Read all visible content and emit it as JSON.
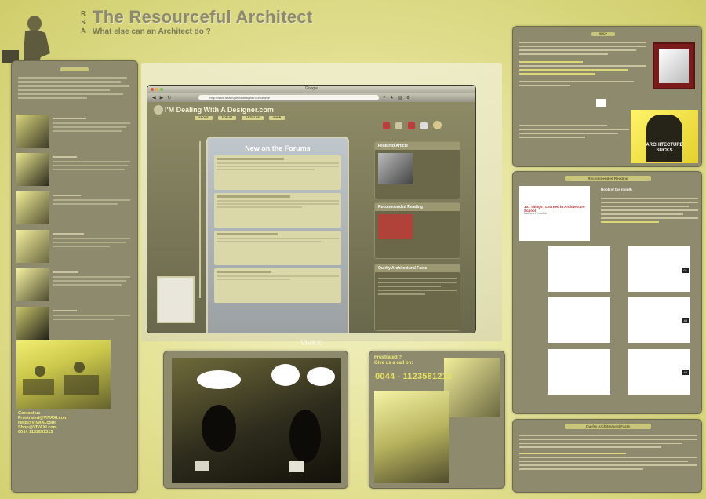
{
  "header": {
    "rsa": [
      "R",
      "S",
      "A"
    ],
    "title": "The Resourceful Architect",
    "subtitle": "What else can an Architect do ?"
  },
  "left_panel": {
    "contact_title": "Contact us",
    "contact_lines": [
      "Frustrated@VIVAXI.com",
      "Help@VIVAXI.com",
      "Shop@VIVAXI.com",
      "0044-1123581213"
    ]
  },
  "browser": {
    "window_title": "Google",
    "url": "http://www.dealingwithadesigner.com/home",
    "site_title": "I'M Dealing With A Designer.com",
    "nav": [
      "ABOUT",
      "FORUM",
      "ARTICLES",
      "SHOP"
    ],
    "forum_heading": "New on the Forums",
    "sidebar_titles": [
      "Featured Article",
      "Recommended Reading",
      "Quirky Architectural Facts"
    ]
  },
  "center": {
    "brand": "VIVAX",
    "frustrated": "Frustrated ?",
    "give_call": "Give us a call on:",
    "phone": "0044 - 1123581213"
  },
  "right": {
    "shop_tag": "SHOP",
    "tshirt_caption": [
      "ARCHITECTURE",
      "SUCKS"
    ],
    "reading_title": "Recommended Reading",
    "book_of_month": "Book of the month",
    "book_title": "101 Things I Learned in Architecture School",
    "book_author": "Matthew Frederick",
    "page_numbers": [
      "01",
      "48",
      "43"
    ],
    "facts_title": "Quirky Architectural Facts"
  },
  "colors": {
    "panel": "#8e8a6e",
    "accent_yellow": "#e8e260",
    "background": "#e6e49a"
  }
}
